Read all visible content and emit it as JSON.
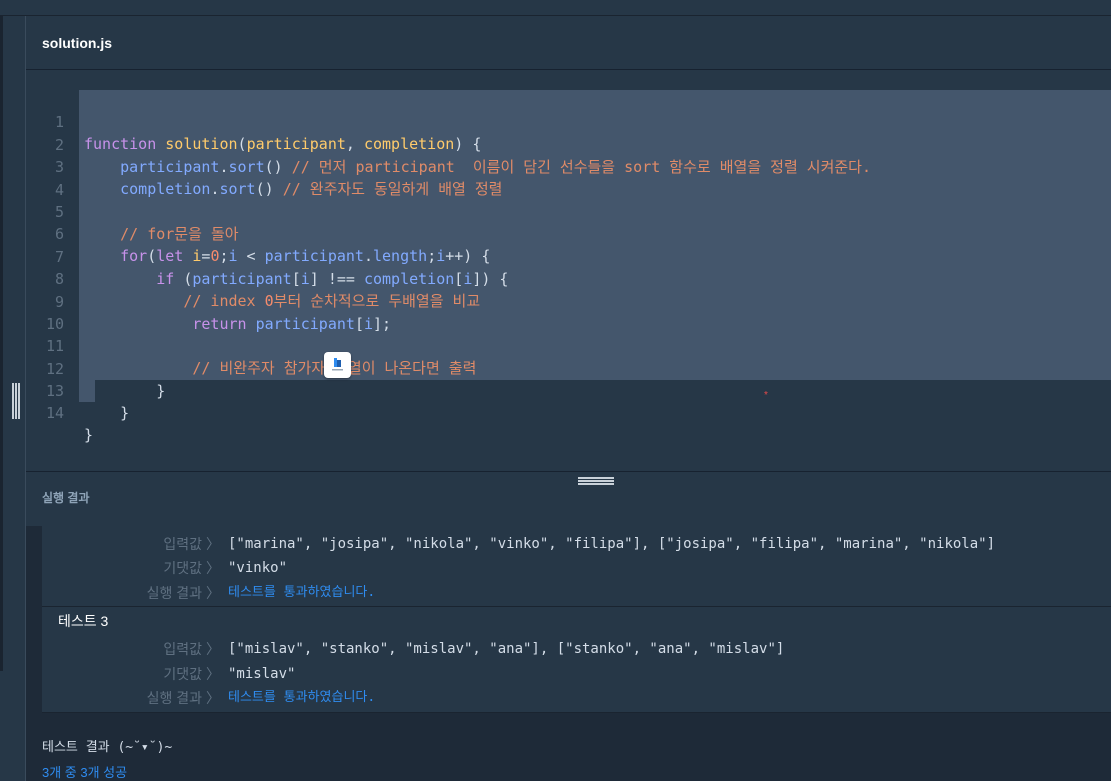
{
  "file": {
    "title": "solution.js"
  },
  "editor": {
    "lines": [
      {
        "n": "1"
      },
      {
        "n": "2"
      },
      {
        "n": "3"
      },
      {
        "n": "4"
      },
      {
        "n": "5"
      },
      {
        "n": "6"
      },
      {
        "n": "7"
      },
      {
        "n": "8"
      },
      {
        "n": "9"
      },
      {
        "n": "10"
      },
      {
        "n": "11"
      },
      {
        "n": "12"
      },
      {
        "n": "13"
      },
      {
        "n": "14"
      }
    ],
    "tokens": {
      "l1": [
        "function",
        "solution",
        "(",
        "participant",
        ", ",
        "completion",
        ") {"
      ],
      "l2": [
        "participant",
        ".",
        "sort",
        "() ",
        "// 먼저 participant  이름이 담긴 선수들을 sort 함수로 배열을 정렬 시켜준다."
      ],
      "l3": [
        "completion",
        ".",
        "sort",
        "() ",
        "// 완주자도 동일하게 배열 정렬"
      ],
      "l5": [
        "// for문을 돌아"
      ],
      "l6": [
        "for",
        "(",
        "let ",
        "i",
        "=",
        "0",
        ";",
        "i",
        " < ",
        "participant",
        ".",
        "length",
        ";",
        "i",
        "++) {"
      ],
      "l7": [
        "if",
        " (",
        "participant",
        "[",
        "i",
        "] !== ",
        "completion",
        "[",
        "i",
        "]) {"
      ],
      "l8": [
        "// index ",
        "0",
        "부터 순차적으로 두배열을 비교"
      ],
      "l9": [
        "return",
        " ",
        "participant",
        "[",
        "i",
        "];"
      ],
      "l11": [
        "// 비완주자 참가자 배열이 나온다면 출력"
      ],
      "l12": [
        "}"
      ],
      "l13": [
        "}"
      ],
      "l14": [
        "}"
      ]
    },
    "red_mark": "*"
  },
  "results": {
    "title": "실행 결과",
    "chevron": "〉",
    "labels": {
      "input": "입력값",
      "expected": "기댓값",
      "result": "실행 결과"
    },
    "test2": {
      "input": "[\"marina\", \"josipa\", \"nikola\", \"vinko\", \"filipa\"], [\"josipa\", \"filipa\", \"marina\", \"nikola\"]",
      "expected": "\"vinko\"",
      "result": "테스트를 통과하였습니다."
    },
    "test3": {
      "name": "테스트 3",
      "input": "[\"mislav\", \"stanko\", \"mislav\", \"ana\"], [\"stanko\", \"ana\", \"mislav\"]",
      "expected": "\"mislav\"",
      "result": "테스트를 통과하였습니다."
    },
    "summary": "테스트 결과 (~˘▾˘)~",
    "summary2": "3개 중 3개 성공"
  },
  "colors": {
    "background": "#263747",
    "keyword": "#c792ea",
    "function": "#ffcb6b",
    "property": "#82aaff",
    "comment": "#e08b68",
    "pass": "#2f8cf0"
  }
}
